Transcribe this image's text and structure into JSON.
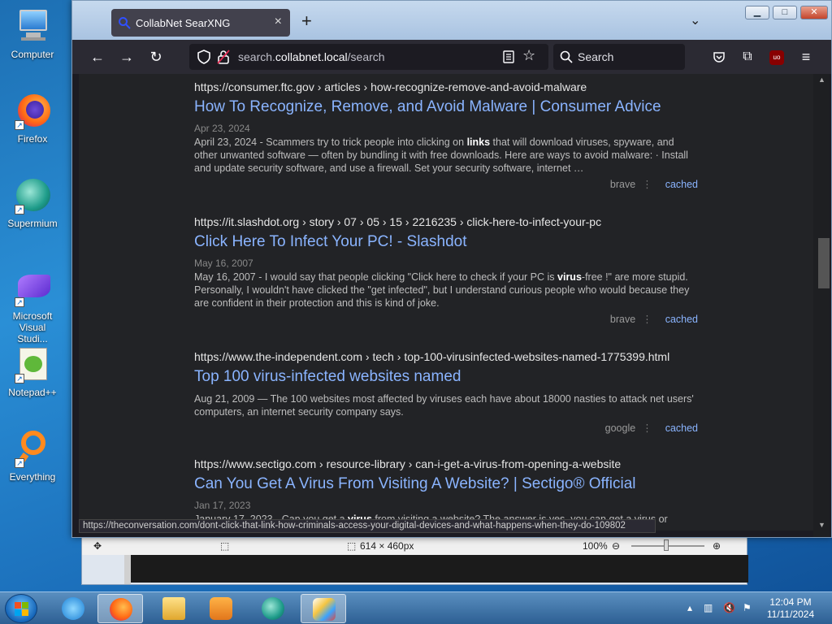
{
  "desktop": {
    "icons": [
      {
        "label": "Computer"
      },
      {
        "label": "Firefox"
      },
      {
        "label": "Supermium"
      },
      {
        "label": "Microsoft Visual Studi..."
      },
      {
        "label": "Notepad++"
      },
      {
        "label": "Everything"
      }
    ]
  },
  "browser": {
    "tab": {
      "title": "CollabNet SearXNG"
    },
    "url": {
      "host_prefix": "search.",
      "host_main": "collabnet.local",
      "path": "/search"
    },
    "searchbar": {
      "placeholder": "Search"
    },
    "status_url": "https://theconversation.com/dont-click-that-link-how-criminals-access-your-digital-devices-and-what-happens-when-they-do-109802"
  },
  "results": [
    {
      "url": "https://consumer.ftc.gov  › articles › how-recognize-remove-and-avoid-malware",
      "title": "How To Recognize, Remove, and Avoid Malware | Consumer Advice",
      "date": "Apr 23, 2024",
      "snippet_pre": "April 23, 2024 - Scammers try to trick people into clicking on ",
      "snippet_bold": "links",
      "snippet_post": " that will download viruses, spyware, and other unwanted software — often by bundling it with free downloads. Here are ways to avoid malware: · Install and update security software, and use a firewall. Set your security software, internet …",
      "engine": "brave",
      "cached": "cached"
    },
    {
      "url": "https://it.slashdot.org  › story › 07 › 05 › 15 › 2216235 › click-here-to-infect-your-pc",
      "title": "Click Here To Infect Your PC! - Slashdot",
      "date": "May 16, 2007",
      "snippet_pre": "May 16, 2007 - I would say that people clicking \"Click here to check if your PC is ",
      "snippet_bold": "virus",
      "snippet_post": "-free !\" are more stupid. Personally, I wouldn't have clicked the \"get infected\", but I understand curious people who would because they are confident in their protection and this is kind of joke.",
      "engine": "brave",
      "cached": "cached"
    },
    {
      "url": "https://www.the-independent.com  › tech › top-100-virusinfected-websites-named-1775399.html",
      "title": "Top 100 virus-infected websites named",
      "date": "",
      "snippet_pre": "Aug 21, 2009 — The 100 websites most affected by viruses each have about 18000 nasties to attack net users' computers, an internet security company says.",
      "snippet_bold": "",
      "snippet_post": "",
      "engine": "google",
      "cached": "cached"
    },
    {
      "url": "https://www.sectigo.com  › resource-library › can-i-get-a-virus-from-opening-a-website",
      "title": "Can You Get A Virus From Visiting A Website? | Sectigo® Official",
      "date": "Jan 17, 2023",
      "snippet_pre": "January 17, 2023 - Can you get a ",
      "snippet_bold": "virus",
      "snippet_post": " from visiting a website? The answer is yes, you can get a virus or",
      "engine": "",
      "cached": ""
    }
  ],
  "paint": {
    "dimensions": "614 × 460px",
    "zoom": "100%"
  },
  "taskbar": {
    "time": "12:04 PM",
    "date": "11/11/2024"
  }
}
